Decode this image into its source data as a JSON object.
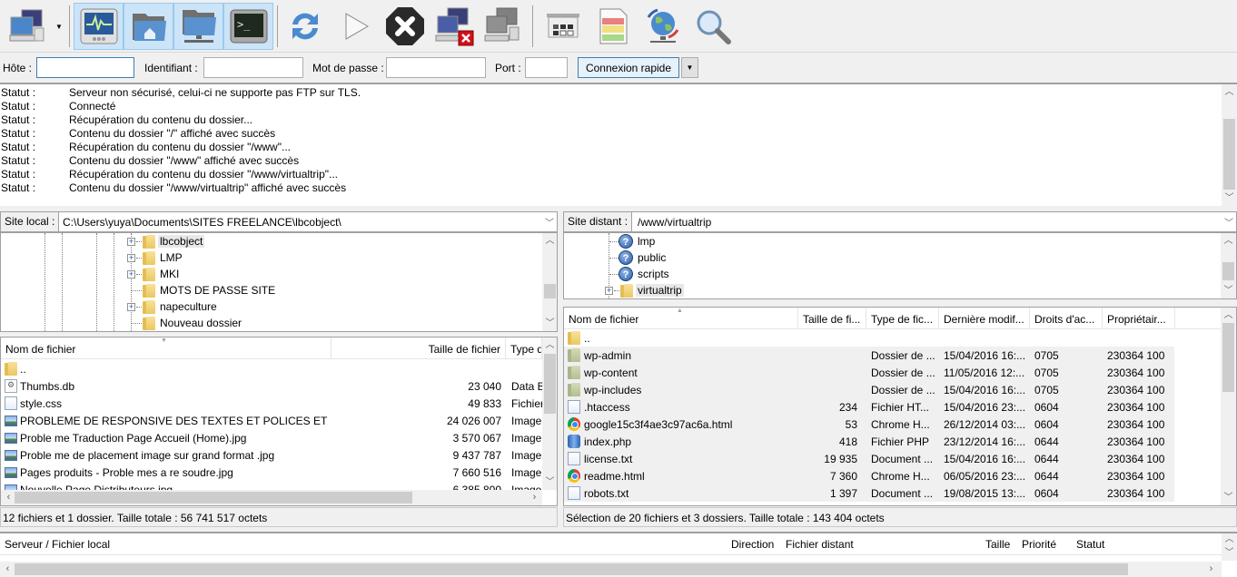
{
  "toolbar": {
    "buttons": [
      {
        "name": "site-manager",
        "icon": "site-manager-icon",
        "pressed": false
      },
      {
        "name": "site-manager-dropdown",
        "icon": "chevron-down-icon",
        "pressed": false
      },
      {
        "name": "toggle-message-log",
        "icon": "message-log-icon",
        "pressed": true
      },
      {
        "name": "toggle-local-tree",
        "icon": "local-tree-icon",
        "pressed": true
      },
      {
        "name": "toggle-remote-tree",
        "icon": "remote-tree-icon",
        "pressed": true
      },
      {
        "name": "toggle-transfer-queue",
        "icon": "transfer-queue-icon",
        "pressed": true
      },
      {
        "name": "refresh",
        "icon": "refresh-icon",
        "pressed": false
      },
      {
        "name": "process-queue",
        "icon": "play-icon",
        "pressed": false
      },
      {
        "name": "cancel-operation",
        "icon": "cancel-icon",
        "pressed": false
      },
      {
        "name": "disconnect",
        "icon": "disconnect-icon",
        "pressed": false
      },
      {
        "name": "reconnect",
        "icon": "reconnect-icon",
        "pressed": false
      },
      {
        "name": "directory-listing-filters",
        "icon": "filter-icon",
        "pressed": false
      },
      {
        "name": "directory-comparison",
        "icon": "compare-icon",
        "pressed": false
      },
      {
        "name": "synchronized-browsing",
        "icon": "sync-browse-icon",
        "pressed": false
      },
      {
        "name": "search-remote-files",
        "icon": "search-icon",
        "pressed": false
      }
    ]
  },
  "quickconnect": {
    "host_label": "Hôte :",
    "host_value": "",
    "user_label": "Identifiant :",
    "user_value": "",
    "pass_label": "Mot de passe :",
    "pass_value": "",
    "port_label": "Port :",
    "port_value": "",
    "connect_label": "Connexion rapide",
    "dropdown_label": "▼"
  },
  "log": [
    {
      "key": "Statut :",
      "msg": "Serveur non sécurisé, celui-ci ne supporte pas FTP sur TLS."
    },
    {
      "key": "Statut :",
      "msg": "Connecté"
    },
    {
      "key": "Statut :",
      "msg": "Récupération du contenu du dossier..."
    },
    {
      "key": "Statut :",
      "msg": "Contenu du dossier \"/\" affiché avec succès"
    },
    {
      "key": "Statut :",
      "msg": "Récupération du contenu du dossier \"/www\"..."
    },
    {
      "key": "Statut :",
      "msg": "Contenu du dossier \"/www\" affiché avec succès"
    },
    {
      "key": "Statut :",
      "msg": "Récupération du contenu du dossier \"/www/virtualtrip\"..."
    },
    {
      "key": "Statut :",
      "msg": "Contenu du dossier \"/www/virtualtrip\" affiché avec succès"
    }
  ],
  "local": {
    "site_label": "Site local :",
    "path": "C:\\Users\\yuya\\Documents\\SITES FREELANCE\\lbcobject\\",
    "tree": [
      {
        "name": "lbcobject",
        "expandable": true,
        "selected": true
      },
      {
        "name": "LMP",
        "expandable": true,
        "selected": false
      },
      {
        "name": "MKI",
        "expandable": true,
        "selected": false
      },
      {
        "name": "MOTS DE PASSE SITE",
        "expandable": false,
        "selected": false
      },
      {
        "name": "napeculture",
        "expandable": true,
        "selected": false
      },
      {
        "name": "Nouveau dossier",
        "expandable": false,
        "selected": false
      }
    ],
    "columns": [
      "Nom de fichier",
      "Taille de fichier",
      "Type d"
    ],
    "files": [
      {
        "name": "..",
        "size": "",
        "type": "",
        "icon": "folder"
      },
      {
        "name": "Thumbs.db",
        "size": "23 040",
        "type": "Data B",
        "icon": "db"
      },
      {
        "name": "style.css",
        "size": "49 833",
        "type": "Fichier",
        "icon": "doc"
      },
      {
        "name": "PROBLEME DE RESPONSIVE DES TEXTES ET POLICES ET CENTR...",
        "size": "24 026 007",
        "type": "Image",
        "icon": "img"
      },
      {
        "name": "Proble me Traduction Page Accueil (Home).jpg",
        "size": "3 570 067",
        "type": "Image",
        "icon": "img"
      },
      {
        "name": "Proble me de placement image sur grand format .jpg",
        "size": "9 437 787",
        "type": "Image",
        "icon": "img"
      },
      {
        "name": "Pages produits - Proble mes a  re soudre.jpg",
        "size": "7 660 516",
        "type": "Image",
        "icon": "img"
      },
      {
        "name": "Nouvelle Page Distributeurs.jpg",
        "size": "6 385 800",
        "type": "Image",
        "icon": "img"
      }
    ],
    "status": "12 fichiers et 1 dossier. Taille totale : 56 741 517 octets"
  },
  "remote": {
    "site_label": "Site distant :",
    "path": "/www/virtualtrip",
    "tree": [
      {
        "name": "lmp",
        "icon": "unknown",
        "expandable": false,
        "selected": false
      },
      {
        "name": "public",
        "icon": "unknown",
        "expandable": false,
        "selected": false
      },
      {
        "name": "scripts",
        "icon": "unknown",
        "expandable": false,
        "selected": false
      },
      {
        "name": "virtualtrip",
        "icon": "folder",
        "expandable": true,
        "selected": true
      }
    ],
    "columns": [
      "Nom de fichier",
      "Taille de fi...",
      "Type de fic...",
      "Dernière modif...",
      "Droits d'ac...",
      "Propriétair..."
    ],
    "files": [
      {
        "name": "..",
        "size": "",
        "type": "",
        "modified": "",
        "perms": "",
        "owner": "",
        "icon": "folder",
        "selected": false
      },
      {
        "name": "wp-admin",
        "size": "",
        "type": "Dossier de ...",
        "modified": "15/04/2016 16:...",
        "perms": "0705",
        "owner": "230364 100",
        "icon": "folder-green",
        "selected": true
      },
      {
        "name": "wp-content",
        "size": "",
        "type": "Dossier de ...",
        "modified": "11/05/2016 12:...",
        "perms": "0705",
        "owner": "230364 100",
        "icon": "folder-green",
        "selected": true
      },
      {
        "name": "wp-includes",
        "size": "",
        "type": "Dossier de ...",
        "modified": "15/04/2016 16:...",
        "perms": "0705",
        "owner": "230364 100",
        "icon": "folder-green",
        "selected": true
      },
      {
        "name": ".htaccess",
        "size": "234",
        "type": "Fichier HT...",
        "modified": "15/04/2016 23:...",
        "perms": "0604",
        "owner": "230364 100",
        "icon": "doc",
        "selected": true
      },
      {
        "name": "google15c3f4ae3c97ac6a.html",
        "size": "53",
        "type": "Chrome H...",
        "modified": "26/12/2014 03:...",
        "perms": "0604",
        "owner": "230364 100",
        "icon": "chrome",
        "selected": true
      },
      {
        "name": "index.php",
        "size": "418",
        "type": "Fichier PHP",
        "modified": "23/12/2014 16:...",
        "perms": "0644",
        "owner": "230364 100",
        "icon": "php",
        "selected": true
      },
      {
        "name": "license.txt",
        "size": "19 935",
        "type": "Document ...",
        "modified": "15/04/2016 16:...",
        "perms": "0644",
        "owner": "230364 100",
        "icon": "doc",
        "selected": true
      },
      {
        "name": "readme.html",
        "size": "7 360",
        "type": "Chrome H...",
        "modified": "06/05/2016 23:...",
        "perms": "0644",
        "owner": "230364 100",
        "icon": "chrome",
        "selected": true
      },
      {
        "name": "robots.txt",
        "size": "1 397",
        "type": "Document ...",
        "modified": "19/08/2015 13:...",
        "perms": "0604",
        "owner": "230364 100",
        "icon": "doc",
        "selected": true
      }
    ],
    "status": "Sélection de 20 fichiers et 3 dossiers. Taille totale : 143 404 octets"
  },
  "queue": {
    "columns": [
      "Serveur / Fichier local",
      "Direction",
      "Fichier distant",
      "Taille",
      "Priorité",
      "Statut"
    ]
  }
}
